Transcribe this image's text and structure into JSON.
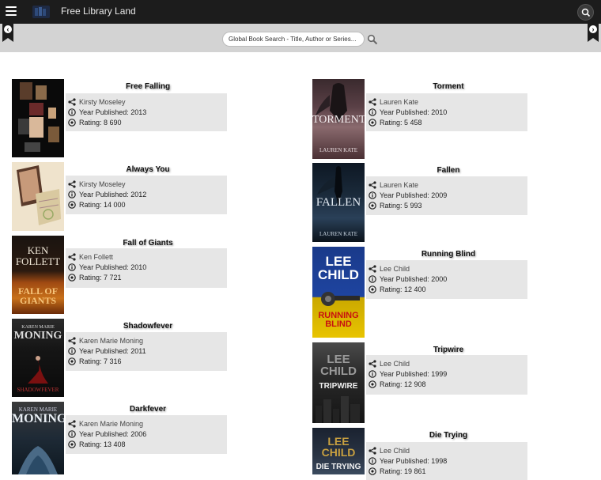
{
  "header": {
    "app_title": "Free Library Land",
    "menu_icon": "hamburger-menu-icon",
    "search_icon": "search-icon"
  },
  "search": {
    "placeholder": "Global Book Search - Title, Author or Series...",
    "value": ""
  },
  "books_left": [
    {
      "title": "Free Falling",
      "author": "Kirsty Moseley",
      "year": "Year Published: 2013",
      "rating": "Rating: 8 690"
    },
    {
      "title": "Always You",
      "author": "Kirsty Moseley",
      "year": "Year Published: 2012",
      "rating": "Rating: 14 000"
    },
    {
      "title": "Fall of Giants",
      "author": "Ken Follett",
      "year": "Year Published: 2010",
      "rating": "Rating: 7 721"
    },
    {
      "title": "Shadowfever",
      "author": "Karen Marie Moning",
      "year": "Year Published: 2011",
      "rating": "Rating: 7 316"
    },
    {
      "title": "Darkfever",
      "author": "Karen Marie Moning",
      "year": "Year Published: 2006",
      "rating": "Rating: 13 408"
    }
  ],
  "books_right": [
    {
      "title": "Torment",
      "author": "Lauren Kate",
      "year": "Year Published: 2010",
      "rating": "Rating: 5 458"
    },
    {
      "title": "Fallen",
      "author": "Lauren Kate",
      "year": "Year Published: 2009",
      "rating": "Rating: 5 993"
    },
    {
      "title": "Running Blind",
      "author": "Lee Child",
      "year": "Year Published: 2000",
      "rating": "Rating: 12 400"
    },
    {
      "title": "Tripwire",
      "author": "Lee Child",
      "year": "Year Published: 1999",
      "rating": "Rating: 12 908"
    },
    {
      "title": "Die Trying",
      "author": "Lee Child",
      "year": "Year Published: 1998",
      "rating": "Rating: 19 861"
    }
  ],
  "covers": {
    "fall_of_giants": {
      "line1": "KEN",
      "line2": "FOLLETT",
      "line3": "FALL OF",
      "line4": "GIANTS"
    },
    "shadowfever": {
      "line1": "KAREN MARIE",
      "line2": "MONING",
      "line3": "SHADOWFEVER"
    },
    "darkfever": {
      "line1": "KAREN MARIE",
      "line2": "MONING"
    },
    "torment": {
      "line1": "TORMENT",
      "line2": "LAUREN KATE"
    },
    "fallen": {
      "line1": "FALLEN",
      "line2": "LAUREN KATE"
    },
    "running_blind": {
      "line1": "LEE",
      "line2": "CHILD",
      "line3": "RUNNING",
      "line4": "BLIND"
    },
    "tripwire": {
      "line1": "LEE",
      "line2": "CHILD",
      "line3": "TRIPWIRE"
    },
    "die_trying": {
      "line1": "LEE",
      "line2": "CHILD",
      "line3": "DIE TRYING"
    }
  },
  "icons": {
    "author": "share-icon",
    "year": "info-icon",
    "rating": "rating-icon"
  }
}
